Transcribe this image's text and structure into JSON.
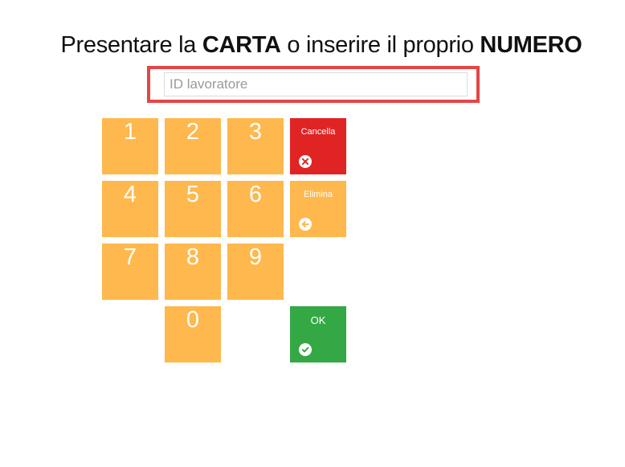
{
  "header": {
    "part1": "Presentare la ",
    "bold1": "CARTA",
    "part2": " o inserire il proprio ",
    "bold2": "NUMERO"
  },
  "id_input": {
    "placeholder": "ID lavoratore",
    "value": ""
  },
  "keypad": {
    "digits": [
      "1",
      "2",
      "3",
      "4",
      "5",
      "6",
      "7",
      "8",
      "9",
      "0"
    ],
    "cancel_label": "Cancella",
    "delete_label": "Elimina",
    "ok_label": "OK"
  },
  "colors": {
    "key": "#ffb84d",
    "cancel": "#e02424",
    "ok": "#35a846",
    "highlight_border": "#e54545"
  },
  "icons": {
    "cancel": "times-circle-icon",
    "delete": "arrow-left-circle-icon",
    "ok": "check-circle-icon"
  }
}
